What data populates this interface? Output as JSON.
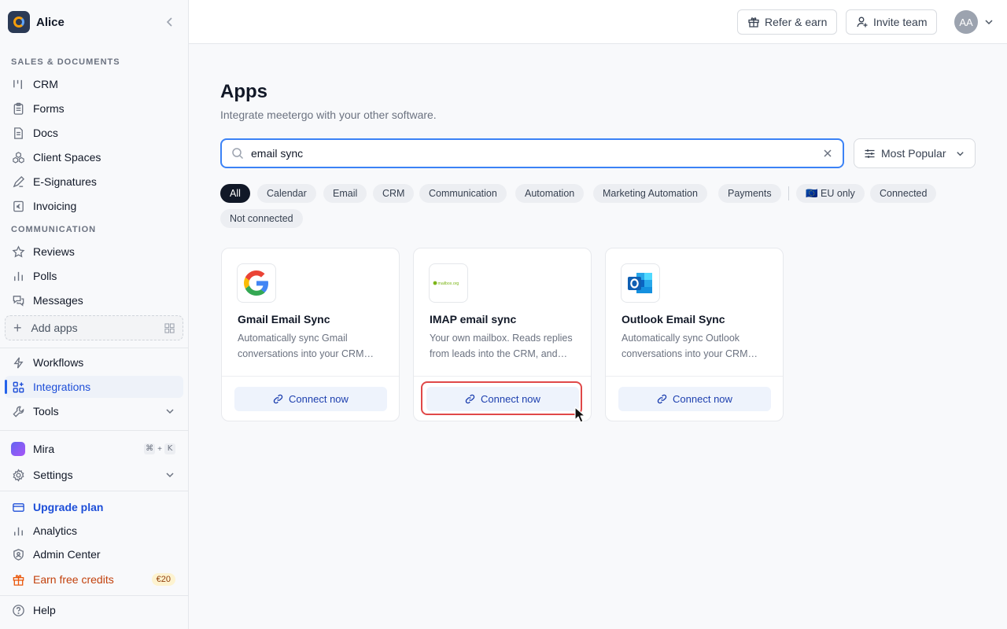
{
  "workspace": {
    "name": "Alice"
  },
  "sidebar": {
    "sections": {
      "sales": "SALES & DOCUMENTS",
      "communication": "COMMUNICATION"
    },
    "items": {
      "crm": "CRM",
      "forms": "Forms",
      "docs": "Docs",
      "client_spaces": "Client Spaces",
      "esignatures": "E-Signatures",
      "invoicing": "Invoicing",
      "reviews": "Reviews",
      "polls": "Polls",
      "messages": "Messages",
      "add_apps": "Add apps",
      "workflows": "Workflows",
      "integrations": "Integrations",
      "tools": "Tools",
      "mira": "Mira",
      "settings": "Settings",
      "upgrade": "Upgrade plan",
      "analytics": "Analytics",
      "admin": "Admin Center",
      "earn": "Earn free credits",
      "help": "Help"
    },
    "mira_shortcut": [
      "⌘",
      "+",
      "K"
    ],
    "earn_badge": "€20",
    "active_item": "Integrations"
  },
  "topbar": {
    "refer": "Refer & earn",
    "invite": "Invite team",
    "avatar": "AA"
  },
  "main": {
    "title": "Apps",
    "subtitle": "Integrate meetergo with your other software.",
    "search_value": "email sync",
    "sort_label": "Most Popular",
    "filters": [
      "All",
      "Calendar",
      "Email",
      "CRM",
      "Communication",
      "Automation",
      "Marketing Automation",
      "Payments",
      "🇪🇺 EU only",
      "Connected",
      "Not connected"
    ],
    "selected_filter": "All",
    "cards": [
      {
        "name": "Gmail Email Sync",
        "desc": "Automatically sync Gmail conversations into your CRM…",
        "action": "Connect now",
        "logo": "google-icon"
      },
      {
        "name": "IMAP email sync",
        "desc": "Your own mailbox. Reads replies from leads into the CRM, and…",
        "action": "Connect now",
        "logo": "mailbox-org-logo",
        "logo_text": "mailbox.org"
      },
      {
        "name": "Outlook Email Sync",
        "desc": "Automatically sync Outlook conversations into your CRM…",
        "action": "Connect now",
        "logo": "outlook-icon"
      }
    ]
  },
  "colors": {
    "accent": "#2563eb",
    "highlight": "#e04848",
    "earn": "#c2410c"
  }
}
